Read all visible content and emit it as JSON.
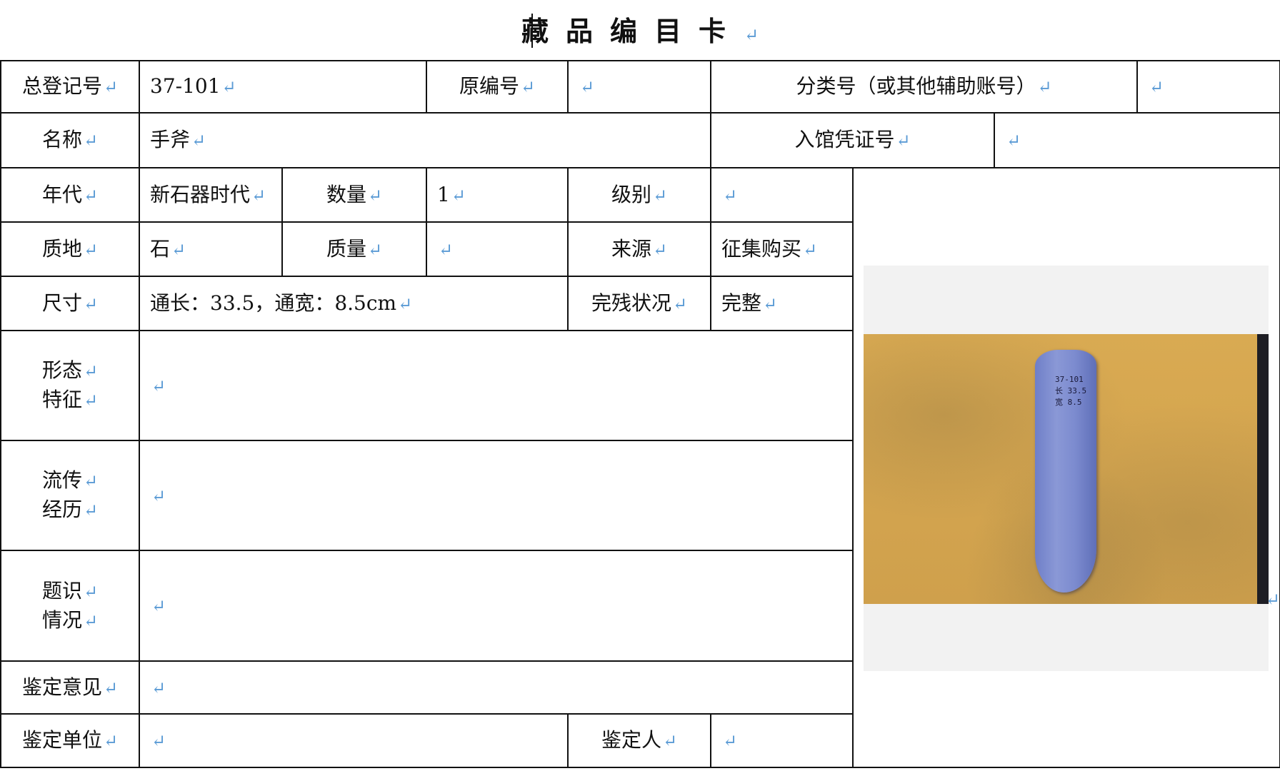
{
  "title": "藏品编目卡",
  "paragraph_mark": "↵",
  "row1": {
    "reg_label": "总登记号",
    "reg_value": "37-101",
    "orig_label": "原编号",
    "orig_value": "",
    "class_label": "分类号（或其他辅助账号）",
    "class_value": ""
  },
  "row2": {
    "name_label": "名称",
    "name_value": "手斧",
    "voucher_label": "入馆凭证号",
    "voucher_value": ""
  },
  "row3": {
    "era_label": "年代",
    "era_value": "新石器时代",
    "qty_label": "数量",
    "qty_value": "1",
    "grade_label": "级别",
    "grade_value": ""
  },
  "row4": {
    "material_label": "质地",
    "material_value": "石",
    "mass_label": "质量",
    "mass_value": "",
    "source_label": "来源",
    "source_value": "征集购买"
  },
  "row5": {
    "size_label": "尺寸",
    "size_value": "通长：33.5，通宽：8.5cm",
    "cond_label": "完残状况",
    "cond_value": "完整"
  },
  "row6": {
    "label_l1": "形态",
    "label_l2": "特征",
    "value": ""
  },
  "row7": {
    "label_l1": "流传",
    "label_l2": "经历",
    "value": ""
  },
  "row8": {
    "label_l1": "题识",
    "label_l2": "情况",
    "value": ""
  },
  "row9": {
    "label": "鉴定意见",
    "value": ""
  },
  "row10": {
    "unit_label": "鉴定单位",
    "unit_value": "",
    "person_label": "鉴定人",
    "person_value": ""
  },
  "photo": {
    "subject": "stone hand axe on yellow background",
    "ink_text": "37-101\n长 33.5\n宽 8.5"
  },
  "colors": {
    "paragraph_mark": "#5b9bd5",
    "background": "#d8a850",
    "axe": "#7c8bcf"
  }
}
